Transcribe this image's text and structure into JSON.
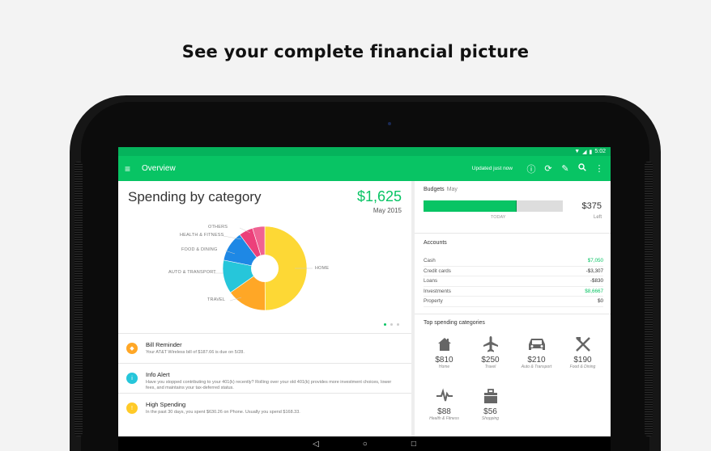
{
  "headline": "See your complete financial picture",
  "status": {
    "time": "5:02"
  },
  "appbar": {
    "title": "Overview",
    "updated": "Updated just now"
  },
  "spending": {
    "title": "Spending by category",
    "amount": "$1,625",
    "month": "May 2015",
    "labels": [
      "OTHERS",
      "HEALTH & FITNESS",
      "FOOD & DINING",
      "AUTO & TRANSPORT",
      "TRAVEL",
      "HOME"
    ]
  },
  "chart_data": {
    "type": "pie",
    "categories": [
      "HOME",
      "TRAVEL",
      "AUTO & TRANSPORT",
      "FOOD & DINING",
      "HEALTH & FITNESS",
      "OTHERS"
    ],
    "values": [
      810,
      250,
      210,
      190,
      88,
      77
    ],
    "colors": [
      "#fdd835",
      "#ffa726",
      "#26c6da",
      "#1e88e5",
      "#ec407a",
      "#f06292"
    ]
  },
  "alerts": [
    {
      "title": "Bill Reminder",
      "body": "Your AT&T Wireless bill of $187.66 is due on 5/28.",
      "color": "#ffa726",
      "icon": "bell-icon"
    },
    {
      "title": "Info Alert",
      "body": "Have you stopped contributing to your 401(k) recently? Rolling over your old 401(k) provides more investment choices, lower fees, and maintains your tax-deferred status.",
      "color": "#26c6da",
      "icon": "info-icon"
    },
    {
      "title": "High Spending",
      "body": "In the past 30 days, you spent $630.26 on Phone.  Usually you spend $168.33.",
      "color": "#ffca28",
      "icon": "warning-icon"
    }
  ],
  "budgets": {
    "label": "Budgets",
    "month": "May",
    "today": "TODAY",
    "amount": "$375",
    "left": "Left",
    "progress": 0.67
  },
  "accounts": {
    "title": "Accounts",
    "rows": [
      {
        "name": "Cash",
        "value": "$7,050"
      },
      {
        "name": "Credit cards",
        "value": "-$3,307"
      },
      {
        "name": "Loans",
        "value": "-$830"
      },
      {
        "name": "Investments",
        "value": "$8,6667"
      },
      {
        "name": "Property",
        "value": "$0"
      }
    ]
  },
  "top": {
    "title": "Top spending categories",
    "cats": [
      {
        "amount": "$810",
        "name": "Home",
        "icon": "home-icon"
      },
      {
        "amount": "$250",
        "name": "Travel",
        "icon": "airplane-icon"
      },
      {
        "amount": "$210",
        "name": "Auto & Transport",
        "icon": "car-icon"
      },
      {
        "amount": "$190",
        "name": "Food & Dining",
        "icon": "utensils-icon"
      },
      {
        "amount": "$88",
        "name": "Health & Fitness",
        "icon": "pulse-icon"
      },
      {
        "amount": "$56",
        "name": "Shopping",
        "icon": "bag-icon"
      }
    ]
  }
}
